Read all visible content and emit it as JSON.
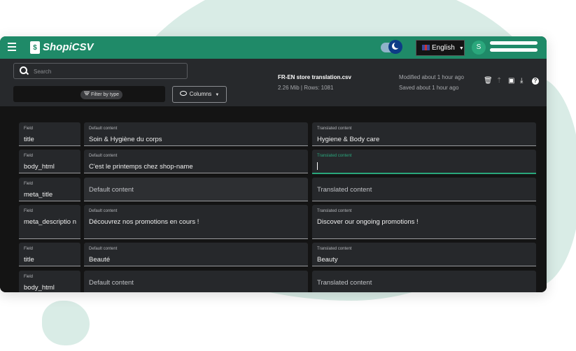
{
  "app": {
    "name": "ShopiCSV",
    "logo_letter": "$"
  },
  "header": {
    "language": "English",
    "avatar_initial": "S"
  },
  "toolbar": {
    "search_placeholder": "Search",
    "filter_label": "Filter by type",
    "columns_label": "Columns",
    "file_name": "FR-EN store translation.csv",
    "file_meta": "2.26 Mib | Rows: 1081",
    "modified": "Modified about 1 hour ago",
    "saved": "Saved about 1 hour ago"
  },
  "labels": {
    "field": "Field",
    "default": "Default content",
    "translated": "Translated content"
  },
  "rows": [
    {
      "field": "title",
      "default": "Soin & Hygiène du corps",
      "translated": "Hygiene & Body care"
    },
    {
      "field": "body_html",
      "default": "C'est le printemps chez shop-name",
      "translated": ""
    },
    {
      "field": "meta_title",
      "default": "",
      "translated": ""
    },
    {
      "field": "meta_descriptio n",
      "default": "Découvrez nos promotions en cours !",
      "translated": "Discover our ongoing promotions !"
    },
    {
      "field": "title",
      "default": "Beauté",
      "translated": "Beauty"
    },
    {
      "field": "body_html",
      "default": "",
      "translated": ""
    }
  ],
  "colors": {
    "brand": "#1f8a68",
    "accent": "#2aa77c",
    "background": "#141414"
  },
  "icons": [
    "menu-icon",
    "moon-icon",
    "uk-flag-icon",
    "search-icon",
    "filter-icon",
    "eye-icon",
    "trash-icon",
    "upload-icon",
    "folder-icon",
    "download-icon",
    "help-icon"
  ]
}
